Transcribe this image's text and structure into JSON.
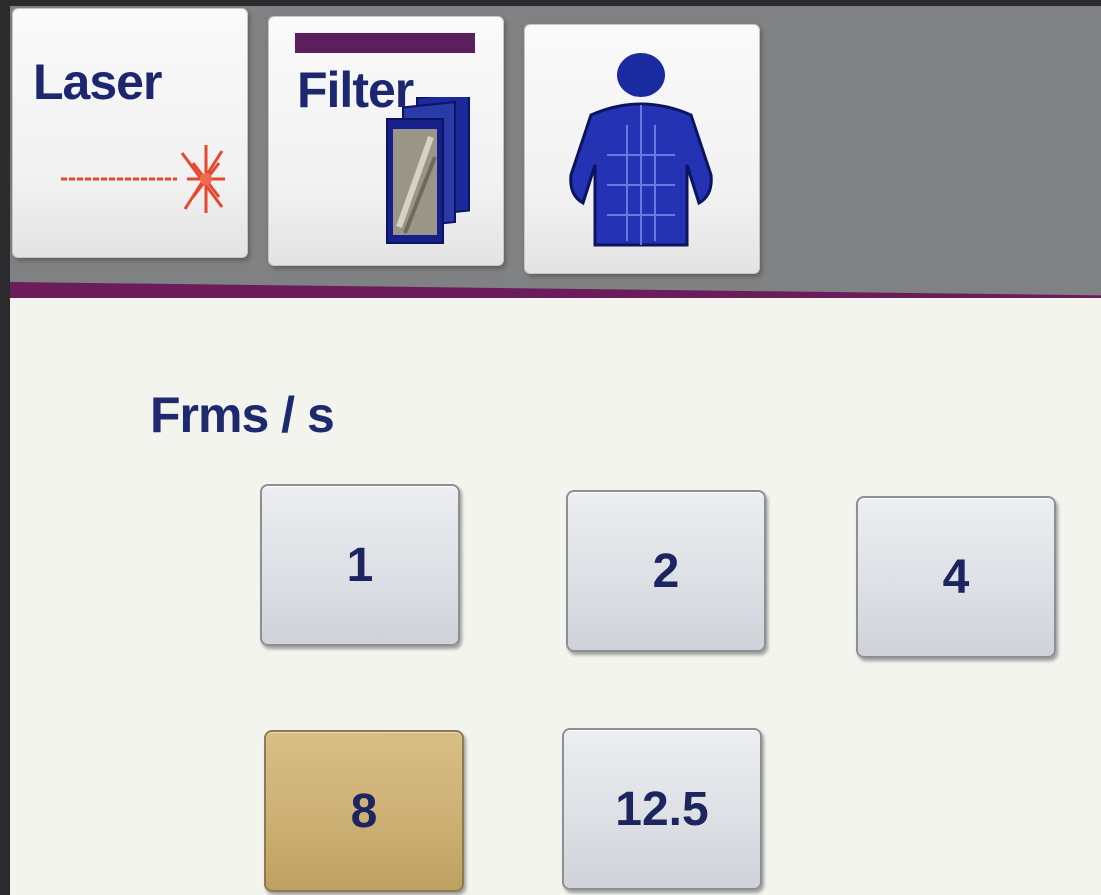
{
  "tabs": [
    {
      "label": "Laser",
      "icon": "laser-burst-icon"
    },
    {
      "label": "Filter",
      "icon": "filter-stack-icon",
      "active": true
    },
    {
      "label": "",
      "icon": "patient-body-icon"
    }
  ],
  "frame_rate": {
    "label": "Frms / s",
    "options": [
      "1",
      "2",
      "4",
      "8",
      "12.5"
    ],
    "selected": "8"
  },
  "colors": {
    "accent_bar": "#6a1d5a",
    "selected_button": "#cdb074",
    "text": "#1d2770",
    "laser_icon": "#e8472f"
  }
}
